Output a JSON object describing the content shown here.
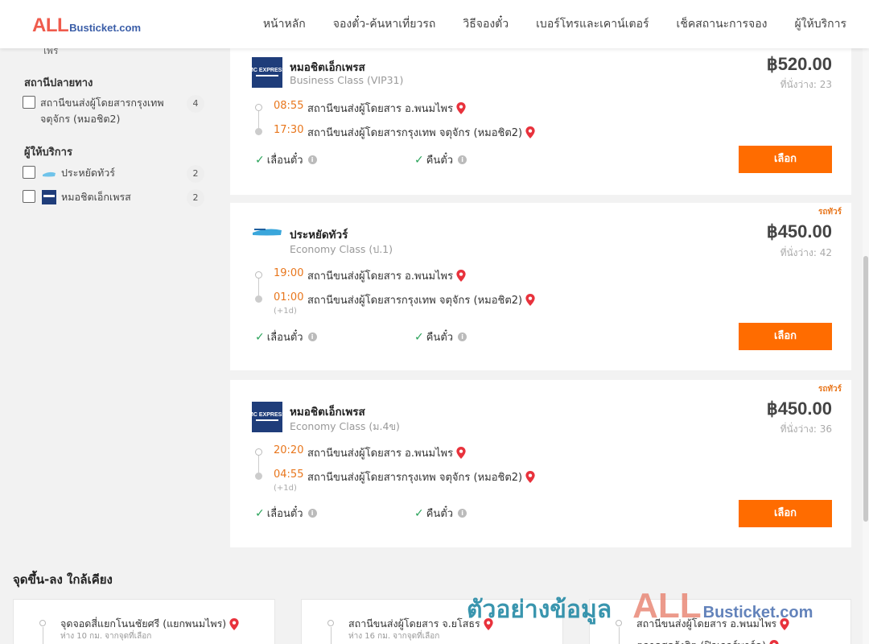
{
  "brand": {
    "all": "ALL",
    "rest": "Busticket.com"
  },
  "nav": [
    "หน้าหลัก",
    "จองตั๋ว-ค้นหาเที่ยวรถ",
    "วิธีจองตั๋ว",
    "เบอร์โทรและเคาน์เตอร์",
    "เช็คสถานะการจอง",
    "ผู้ให้บริการ"
  ],
  "sidebar": {
    "cut_text": "ไพร",
    "dest_title": "สถานีปลายทาง",
    "dest_item": {
      "label": "สถานีขนส่งผู้โดยสารกรุงเทพ จตุจักร (หมอชิต2)",
      "count": "4"
    },
    "op_title": "ผู้ให้บริการ",
    "operators": [
      {
        "label": "ประหยัดทัวร์",
        "count": "2"
      },
      {
        "label": "หมอชิตเอ็กเพรส",
        "count": "2"
      }
    ]
  },
  "trips": [
    {
      "operator": "หมอชิตเอ็กเพรส",
      "class": "Business Class (VIP31)",
      "price": "฿520.00",
      "seats": "ที่นั่งว่าง: 23",
      "ribbon": "",
      "dep_time": "08:55",
      "dep_place": "สถานีขนส่งผู้โดยสาร อ.พนมไพร",
      "arr_time": "17:30",
      "arr_place": "สถานีขนส่งผู้โดยสารกรุงเทพ จตุจักร (หมอชิต2)",
      "next_day": "",
      "feature_change": "เลื่อนตั๋ว",
      "feature_refund": "คืนตั๋ว",
      "button": "เลือก"
    },
    {
      "operator": "ประหยัดทัวร์",
      "class": "Economy Class (ป.1)",
      "price": "฿450.00",
      "seats": "ที่นั่งว่าง: 42",
      "ribbon": "รถทัวร์",
      "dep_time": "19:00",
      "dep_place": "สถานีขนส่งผู้โดยสาร อ.พนมไพร",
      "arr_time": "01:00",
      "arr_place": "สถานีขนส่งผู้โดยสารกรุงเทพ จตุจักร (หมอชิต2)",
      "next_day": "(+1d)",
      "feature_change": "เลื่อนตั๋ว",
      "feature_refund": "คืนตั๋ว",
      "button": "เลือก"
    },
    {
      "operator": "หมอชิตเอ็กเพรส",
      "class": "Economy Class (ม.4ข)",
      "price": "฿450.00",
      "seats": "ที่นั่งว่าง: 36",
      "ribbon": "รถทัวร์",
      "dep_time": "20:20",
      "dep_place": "สถานีขนส่งผู้โดยสาร อ.พนมไพร",
      "arr_time": "04:55",
      "arr_place": "สถานีขนส่งผู้โดยสารกรุงเทพ จตุจักร (หมอชิต2)",
      "next_day": "(+1d)",
      "feature_change": "เลื่อนตั๋ว",
      "feature_refund": "คืนตั๋ว",
      "button": "เลือก"
    }
  ],
  "nearby": {
    "title": "จุดขึ้น-ลง ใกล้เคียง",
    "items": [
      {
        "name": "จุดจอดสี่แยกโนนชัยศรี (แยกพนมไพร)",
        "dist": "ห่าง 10 กม. จากจุดที่เลือก",
        "next": ""
      },
      {
        "name": "สถานีขนส่งผู้โดยสาร จ.ยโสธร",
        "dist": "ห่าง 16 กม. จากจุดที่เลือก",
        "next": ""
      },
      {
        "name": "สถานีขนส่งผู้โดยสาร อ.พนมไพร",
        "dist": "",
        "next": "ตลาดสดรังสิต (ฟิวเจอร์พาร์ค)"
      }
    ]
  },
  "watermark": {
    "text": "ตัวอย่างข้อมูล",
    "all": "ALL",
    "rest": "Busticket.com"
  },
  "colors": {
    "accent": "#ff6c00",
    "time": "#e8761c",
    "check": "#2aa35a",
    "pin": "#e8323c",
    "brand_red": "#ef5b4c",
    "brand_blue": "#3b5ea8"
  },
  "icons": [
    "check-icon",
    "info-icon",
    "map-pin-icon",
    "operator-logo"
  ]
}
